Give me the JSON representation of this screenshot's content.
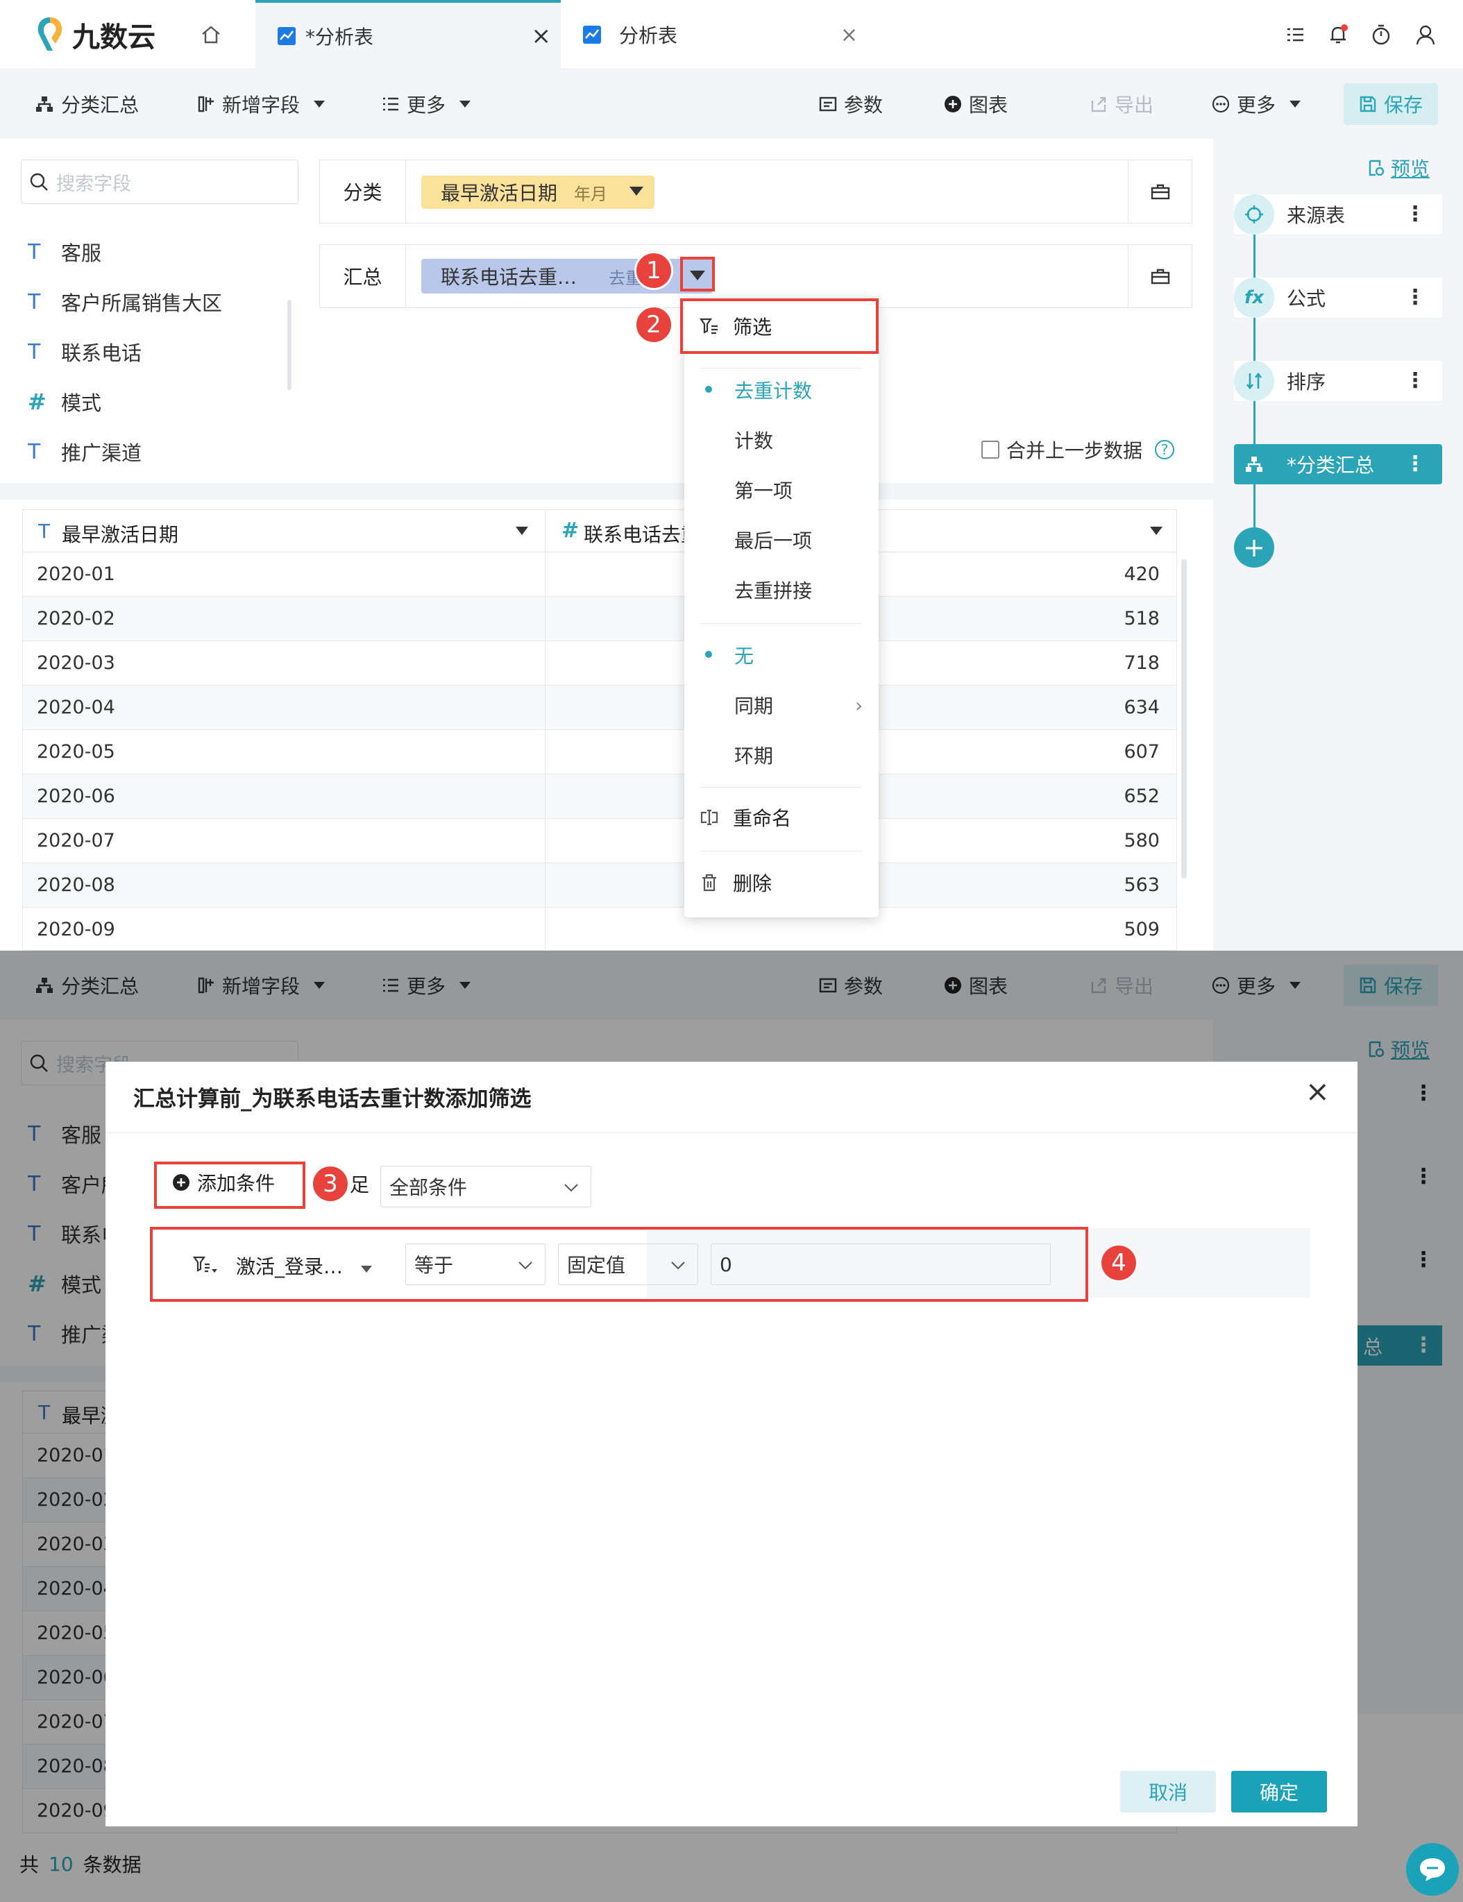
{
  "app": {
    "logo_text": "九数云"
  },
  "tabs": [
    {
      "label": "*分析表",
      "active": true,
      "close": "×"
    },
    {
      "label": "分析表",
      "active": false,
      "close": "×"
    }
  ],
  "toolbar": {
    "group_summary": "分类汇总",
    "add_field": "新增字段",
    "more_left": "更多",
    "params": "参数",
    "chart": "图表",
    "export": "导出",
    "more_right": "更多",
    "save": "保存"
  },
  "field_panel": {
    "search_placeholder": "搜索字段",
    "fields": [
      {
        "type": "T",
        "name": "客服"
      },
      {
        "type": "T",
        "name": "客户所属销售大区"
      },
      {
        "type": "T",
        "name": "联系电话"
      },
      {
        "type": "#",
        "name": "模式"
      },
      {
        "type": "T",
        "name": "推广渠道"
      }
    ]
  },
  "config": {
    "group_label": "分类",
    "group_field": "最早激活日期",
    "group_field_tag": "年月",
    "summary_label": "汇总",
    "summary_field": "联系电话去重…",
    "summary_field_tag": "去重",
    "merge_label": "合并上一步数据",
    "help": "?"
  },
  "table": {
    "col1": "最早激活日期",
    "col2": "联系电话去重",
    "col1_type": "T",
    "col2_type": "#",
    "rows": [
      {
        "date": "2020-01",
        "value": "420"
      },
      {
        "date": "2020-02",
        "value": "518"
      },
      {
        "date": "2020-03",
        "value": "718"
      },
      {
        "date": "2020-04",
        "value": "634"
      },
      {
        "date": "2020-05",
        "value": "607"
      },
      {
        "date": "2020-06",
        "value": "652"
      },
      {
        "date": "2020-07",
        "value": "580"
      },
      {
        "date": "2020-08",
        "value": "563"
      },
      {
        "date": "2020-09",
        "value": "509"
      }
    ]
  },
  "dropdown": {
    "filter": "筛选",
    "agg": [
      "去重计数",
      "计数",
      "第一项",
      "最后一项",
      "去重拼接"
    ],
    "compare": [
      "无",
      "同期",
      "环期"
    ],
    "rename": "重命名",
    "delete": "删除"
  },
  "flow": {
    "preview": "预览",
    "nodes": [
      {
        "label": "来源表"
      },
      {
        "label": "公式"
      },
      {
        "label": "排序"
      },
      {
        "label": "*分类汇总"
      }
    ],
    "add": "+"
  },
  "badges": [
    "1",
    "2",
    "3",
    "4"
  ],
  "modal": {
    "title": "汇总计算前_为联系电话去重计数添加筛选",
    "close": "×",
    "add_condition": "添加条件",
    "satisfy_suffix": "足",
    "all_conditions": "全部条件",
    "cond_field": "激活_登录…",
    "cond_op": "等于",
    "cond_valtype": "固定值",
    "cond_value": "0",
    "cancel": "取消",
    "confirm": "确定"
  },
  "bg": {
    "partial": {
      "field_label_2": "客户所",
      "field_label_3": "联系电",
      "field_label_5": "推广渠",
      "table_col": "最早激",
      "node_tail": "总"
    },
    "footer": {
      "prefix": "共",
      "count": "10",
      "suffix": "条数据"
    }
  },
  "colors": {
    "accent": "#2aa4b6",
    "badge": "#e8423c",
    "tag_yellow": "#fbe29a",
    "tag_blue": "#b9c7ea"
  }
}
